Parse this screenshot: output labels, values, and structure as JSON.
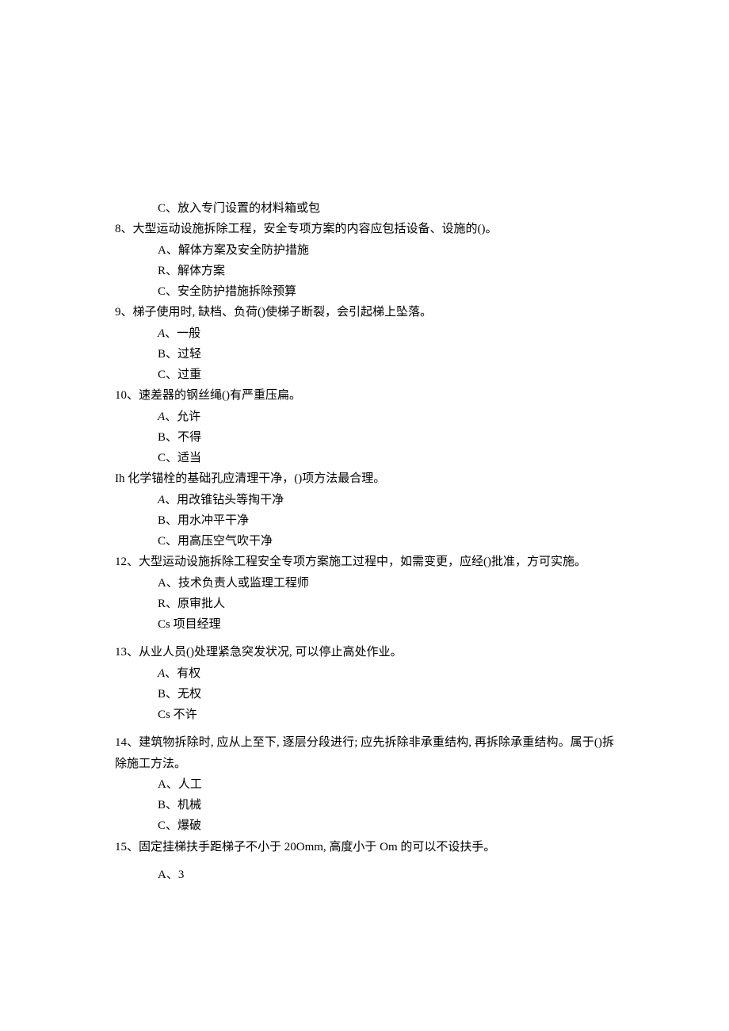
{
  "lines": {
    "l0": "C、放入专门设置的材料箱或包",
    "q8": "8、大型运动设施拆除工程，安全专项方案的内容应包括设备、设施的()。",
    "q8a": "A、解体方案及安全防护措施",
    "q8b": "R、解体方案",
    "q8c": "C、安全防护措施拆除预算",
    "q9": "9、梯子使用时, 缺档、负荷()使梯子断裂，会引起梯上坠落。",
    "q9a_prefix": "A",
    "q9a_rest": "、一般",
    "q9b": "B、过轻",
    "q9c": "C、过重",
    "q10": "10、速差器的钢丝绳()有严重压扁。",
    "q10a_prefix": "A",
    "q10a_rest": "、允许",
    "q10b": "B、不得",
    "q10c": "C、适当",
    "q11": "Ih 化学锚栓的基础孔应清理干净，()项方法最合理。",
    "q11a_prefix": "A",
    "q11a_rest": "、用改锥钻头等掏干净",
    "q11b": "B、用水冲平干净",
    "q11c": "C、用高压空气吹干净",
    "q12": "12、大型运动设施拆除工程安全专项方案施工过程中，如需变更，应经()批准，方可实施。",
    "q12a": "A、技术负责人或监理工程师",
    "q12b": "R、原审批人",
    "q12c": "Cs 项目经理",
    "q13": "13、从业人员()处理紧急突发状况, 可以停止高处作业。",
    "q13a_prefix": "A",
    "q13a_rest": "、有权",
    "q13b": "B、无权",
    "q13c": "Cs 不许",
    "q14": "14、建筑物拆除时, 应从上至下, 逐层分段进行; 应先拆除非承重结构, 再拆除承重结构。属于()拆除施工方法。",
    "q14a": "A、人工",
    "q14b": "B、机械",
    "q14c": "C、爆破",
    "q15": "15、固定挂梯扶手距梯子不小于 20Omm, 高度小于 Om 的可以不设扶手。",
    "q15a": "A、3"
  }
}
